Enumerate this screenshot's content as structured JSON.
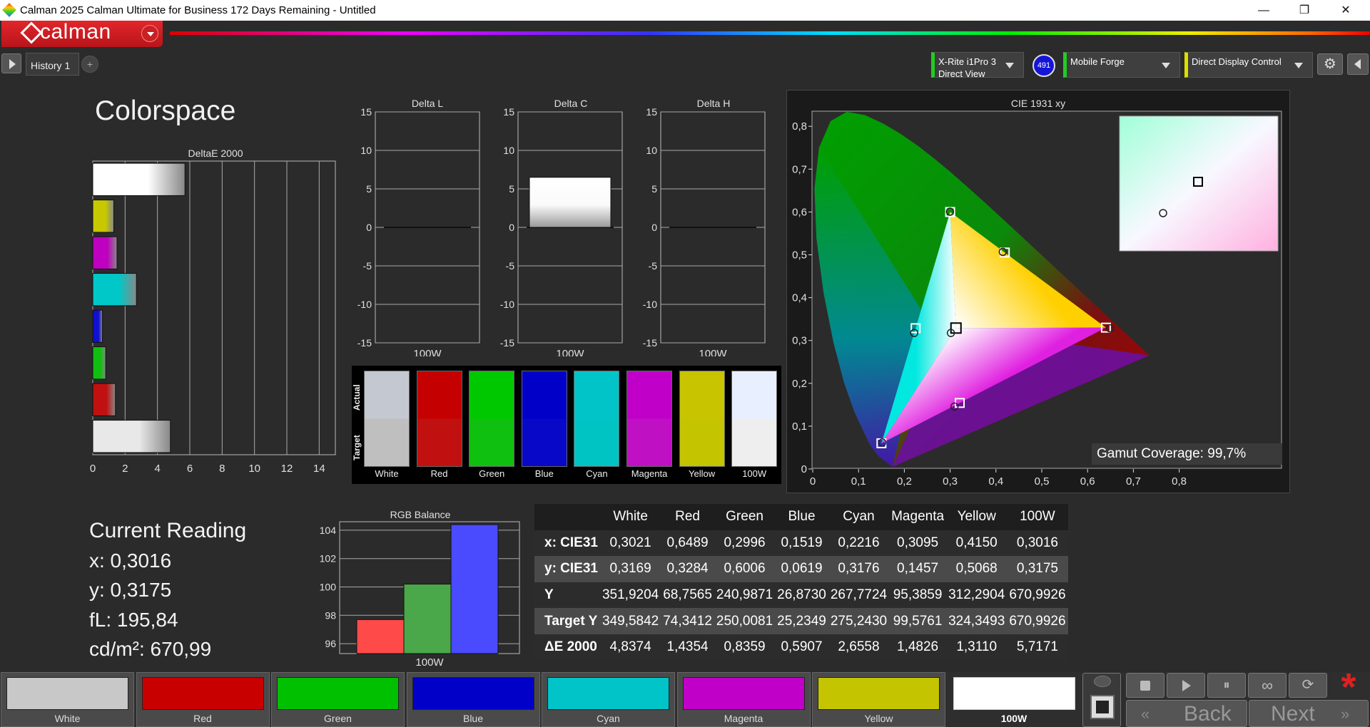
{
  "window": {
    "title": "Calman 2025 Calman Ultimate for Business 172 Days Remaining  - Untitled",
    "minimize": "—",
    "restore": "❐",
    "close": "✕"
  },
  "brand": {
    "name": "calman"
  },
  "tabs": [
    {
      "label": "History 1"
    }
  ],
  "tab_add": "+",
  "devices": [
    {
      "line1": "X-Rite i1Pro 3",
      "line2": "Direct View",
      "accent": "#22cc22",
      "badge": "491"
    },
    {
      "line1": "Mobile Forge",
      "line2": "",
      "accent": "#22cc22"
    },
    {
      "line1": "Direct Display Control",
      "line2": "",
      "accent": "#dddd00"
    }
  ],
  "page_title": "Colorspace",
  "deltaE": {
    "title": "DeltaE 2000",
    "ticks": [
      "0",
      "2",
      "4",
      "6",
      "8",
      "10",
      "12",
      "14"
    ],
    "xlim": [
      0,
      15
    ],
    "bars": [
      {
        "label": "White",
        "value": 5.7,
        "color": "#ffffff"
      },
      {
        "label": "Yellow",
        "value": 1.3,
        "color": "#c8c800"
      },
      {
        "label": "Magenta",
        "value": 1.5,
        "color": "#c000c0"
      },
      {
        "label": "Cyan",
        "value": 2.7,
        "color": "#00c8c8"
      },
      {
        "label": "Blue",
        "value": 0.6,
        "color": "#1010d0"
      },
      {
        "label": "Green",
        "value": 0.8,
        "color": "#10c010"
      },
      {
        "label": "Red",
        "value": 1.4,
        "color": "#c01010"
      },
      {
        "label": "100W",
        "value": 4.8,
        "color": "#e8e8e8"
      }
    ]
  },
  "delta_charts": [
    {
      "title": "Delta L",
      "xlabel": "100W",
      "value": 0
    },
    {
      "title": "Delta C",
      "xlabel": "100W",
      "value": 6.5
    },
    {
      "title": "Delta H",
      "xlabel": "100W",
      "value": 0
    }
  ],
  "delta_ticks": [
    "15",
    "10",
    "5",
    "0",
    "-5",
    "-10",
    "-15"
  ],
  "actual_target": {
    "actual_label": "Actual",
    "target_label": "Target",
    "swatches": [
      {
        "label": "White",
        "actual": "#c4c8d0",
        "target": "#bfbfbf"
      },
      {
        "label": "Red",
        "actual": "#c40000",
        "target": "#c01010"
      },
      {
        "label": "Green",
        "actual": "#00c800",
        "target": "#10c010"
      },
      {
        "label": "Blue",
        "actual": "#0000c8",
        "target": "#0808c8"
      },
      {
        "label": "Cyan",
        "actual": "#00c4c8",
        "target": "#00c4c4"
      },
      {
        "label": "Magenta",
        "actual": "#c000c8",
        "target": "#c010c4"
      },
      {
        "label": "Yellow",
        "actual": "#c8c400",
        "target": "#c4c400"
      },
      {
        "label": "100W",
        "actual": "#e8f0ff",
        "target": "#eeeeee"
      }
    ]
  },
  "cie": {
    "title": "CIE 1931 xy",
    "xticks": [
      "0",
      "0,1",
      "0,2",
      "0,3",
      "0,4",
      "0,5",
      "0,6",
      "0,7",
      "0,8"
    ],
    "yticks": [
      "0",
      "0,1",
      "0,2",
      "0,3",
      "0,4",
      "0,5",
      "0,6",
      "0,7",
      "0,8"
    ],
    "gamut_coverage_label": "Gamut Coverage:",
    "gamut_coverage_value": "99,7%",
    "targets": [
      [
        0.64,
        0.33
      ],
      [
        0.3,
        0.6
      ],
      [
        0.15,
        0.06
      ],
      [
        0.2246,
        0.3287
      ],
      [
        0.3209,
        0.1542
      ],
      [
        0.4193,
        0.5053
      ],
      [
        0.3127,
        0.329
      ]
    ],
    "measured": [
      [
        0.6489,
        0.3284
      ],
      [
        0.2996,
        0.6006
      ],
      [
        0.1519,
        0.0619
      ],
      [
        0.2216,
        0.3176
      ],
      [
        0.3095,
        0.1457
      ],
      [
        0.415,
        0.5068
      ],
      [
        0.3016,
        0.3175
      ]
    ]
  },
  "reading": {
    "title": "Current Reading",
    "x": "x: 0,3016",
    "y": "y: 0,3175",
    "fl": "fL: 195,84",
    "cdm2": "cd/m²: 670,99"
  },
  "rgb_balance": {
    "title": "RGB Balance",
    "xlabel": "100W",
    "yticks": [
      "104",
      "102",
      "100",
      "98",
      "96"
    ],
    "ylim": [
      95.3,
      104.6
    ],
    "series": [
      {
        "name": "R",
        "value": 97.7,
        "color": "#ff4a4a"
      },
      {
        "name": "G",
        "value": 100.2,
        "color": "#4aa84a"
      },
      {
        "name": "B",
        "value": 104.4,
        "color": "#4a4aff"
      }
    ]
  },
  "table": {
    "columns": [
      "",
      "White",
      "Red",
      "Green",
      "Blue",
      "Cyan",
      "Magenta",
      "Yellow",
      "100W"
    ],
    "rows": [
      [
        "x: CIE31",
        "0,3021",
        "0,6489",
        "0,2996",
        "0,1519",
        "0,2216",
        "0,3095",
        "0,4150",
        "0,3016"
      ],
      [
        "y: CIE31",
        "0,3169",
        "0,3284",
        "0,6006",
        "0,0619",
        "0,3176",
        "0,1457",
        "0,5068",
        "0,3175"
      ],
      [
        "Y",
        "351,9204",
        "68,7565",
        "240,9871",
        "26,8730",
        "267,7724",
        "95,3859",
        "312,2904",
        "670,9926"
      ],
      [
        "Target Y",
        "349,5842",
        "74,3412",
        "250,0081",
        "25,2349",
        "275,2430",
        "99,5761",
        "324,3493",
        "670,9926"
      ],
      [
        "ΔE 2000",
        "4,8374",
        "1,4354",
        "0,8359",
        "0,5907",
        "2,6558",
        "1,4826",
        "1,3110",
        "5,7171"
      ]
    ]
  },
  "bottom_swatches": [
    {
      "label": "White",
      "color": "#c8c8c8"
    },
    {
      "label": "Red",
      "color": "#c80000"
    },
    {
      "label": "Green",
      "color": "#00c000"
    },
    {
      "label": "Blue",
      "color": "#0000c8"
    },
    {
      "label": "Cyan",
      "color": "#00c4c8"
    },
    {
      "label": "Magenta",
      "color": "#c000c8"
    },
    {
      "label": "Yellow",
      "color": "#c4c400"
    },
    {
      "label": "100W",
      "color": "#ffffff"
    }
  ],
  "nav": {
    "back": "Back",
    "next": "Next"
  }
}
